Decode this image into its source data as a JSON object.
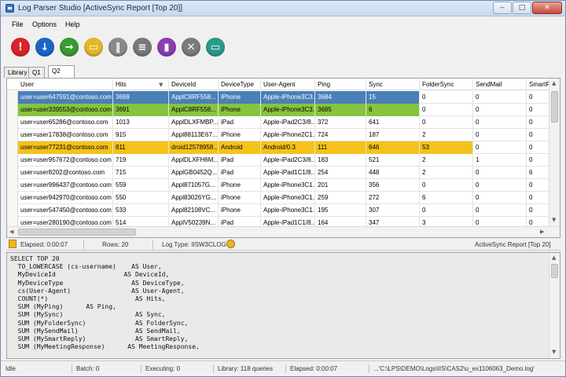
{
  "window": {
    "title": "Log Parser Studio  [ActiveSync Report [Top 20]]"
  },
  "menu": [
    "File",
    "Options",
    "Help"
  ],
  "toolbar": [
    {
      "icon": "stop-icon",
      "color": "#d9242b",
      "glyph": "!"
    },
    {
      "icon": "download-icon",
      "color": "#1b64c8",
      "glyph": "↓"
    },
    {
      "icon": "run-arrow-icon",
      "color": "#3a9a33",
      "glyph": "→"
    },
    {
      "icon": "folder-open-icon",
      "color": "#e3b72a",
      "glyph": "▭"
    },
    {
      "icon": "pause-icon",
      "color": "#8a8a8a",
      "glyph": "‖"
    },
    {
      "icon": "document-icon",
      "color": "#7a7a7a",
      "glyph": "≡"
    },
    {
      "icon": "chart-icon",
      "color": "#8b3fae",
      "glyph": "▮"
    },
    {
      "icon": "cancel-icon",
      "color": "#7c7c7c",
      "glyph": "✕"
    },
    {
      "icon": "export-icon",
      "color": "#2a9b8a",
      "glyph": "▭"
    }
  ],
  "tabs": [
    "Library",
    "Q1",
    "Q2"
  ],
  "grid": {
    "columns": [
      "User",
      "Hits",
      "DeviceId",
      "DeviceType",
      "User-Agent",
      "Ping",
      "Sync",
      "FolderSync",
      "SendMail",
      "SmartRep"
    ],
    "rows": [
      {
        "cells": [
          "user=user647591@contoso.com",
          "3699",
          "ApplC8RF558...",
          "iPhone",
          "Apple-iPhone3C3...",
          "3684",
          "15",
          "0",
          "0",
          "0"
        ],
        "highlight": "#4a7fb8"
      },
      {
        "cells": [
          "user=user339553@contoso.com",
          "3691",
          "ApplC8RF558...",
          "iPhone",
          "Apple-iPhone3C3...",
          "3685",
          "6",
          "0",
          "0",
          "0"
        ],
        "highlight": "#86c440"
      },
      {
        "cells": [
          "user=user65286@contoso.com",
          "1013",
          "ApplDLXFMBP...",
          "iPad",
          "Apple-iPad2C3/8...",
          "372",
          "641",
          "0",
          "0",
          "0"
        ],
        "highlight": ""
      },
      {
        "cells": [
          "user=user17838@contoso.com",
          "915",
          "Appl88113E67...",
          "iPhone",
          "Apple-iPhone2C1...",
          "724",
          "187",
          "2",
          "0",
          "0"
        ],
        "highlight": ""
      },
      {
        "cells": [
          "user=user77231@contoso.com",
          "811",
          "droid12578958...",
          "Android",
          "Android/0.3",
          "111",
          "646",
          "53",
          "0",
          "0"
        ],
        "highlight": "#f4c21a"
      },
      {
        "cells": [
          "user=user957672@contoso.com",
          "719",
          "ApplDLXFH6M...",
          "iPad",
          "Apple-iPad2C3/8...",
          "183",
          "521",
          "2",
          "1",
          "0"
        ],
        "highlight": ""
      },
      {
        "cells": [
          "user=user8202@contoso.com",
          "715",
          "ApplGB0452Q...",
          "iPad",
          "Apple-iPad1C1/8...",
          "254",
          "448",
          "2",
          "0",
          "6"
        ],
        "highlight": ""
      },
      {
        "cells": [
          "user=user996437@contoso.com",
          "559",
          "Appl871057G...",
          "iPhone",
          "Apple-iPhone3C1...",
          "201",
          "356",
          "0",
          "0",
          "0"
        ],
        "highlight": ""
      },
      {
        "cells": [
          "user=user942970@contoso.com",
          "550",
          "Appl83026YG...",
          "iPhone",
          "Apple-iPhone3C1...",
          "259",
          "272",
          "6",
          "0",
          "0"
        ],
        "highlight": ""
      },
      {
        "cells": [
          "user=user547450@contoso.com",
          "533",
          "Appl82108VC...",
          "iPhone",
          "Apple-iPhone3C1...",
          "195",
          "307",
          "0",
          "0",
          "0"
        ],
        "highlight": ""
      },
      {
        "cells": [
          "user=user280190@contoso.com",
          "514",
          "ApplV50239N...",
          "iPad",
          "Apple-iPad1C1/8...",
          "164",
          "347",
          "3",
          "0",
          "0"
        ],
        "highlight": ""
      }
    ]
  },
  "info": {
    "elapsed": "Elapsed: 0:00:07",
    "rows": "Rows: 20",
    "logtype": "Log Type: IISW3CLOG",
    "report": "ActiveSync Report [Top 20]"
  },
  "query": "SELECT TOP 20\n  TO_LOWERCASE (cs-username)    AS User,\n  MyDeviceId                  AS DeviceId,\n  MyDeviceType                  AS DeviceType,\n  cs(User-Agent)                AS User-Agent,\n  COUNT(*)                       AS Hits,\n  SUM (MyPing)      AS Ping,\n  SUM (MySync)                   AS Sync,\n  SUM (MyFolderSync)             AS FolderSync,\n  SUM (MySendMail)               AS SendMail,\n  SUM (MySmartReply)             AS SmartReply,\n  SUM (MyMeetingResponse)      AS MeetingResponse,",
  "status": {
    "state": "Idle",
    "batch": "Batch: 0",
    "executing": "Executing: 0",
    "library": "Library: 118 queries",
    "elapsed": "Elapsed: 0:00:07",
    "path": "...'C:\\LPS\\DEMO\\Logs\\IIS\\CAS2\\u_ex1106063_Demo.log'"
  }
}
